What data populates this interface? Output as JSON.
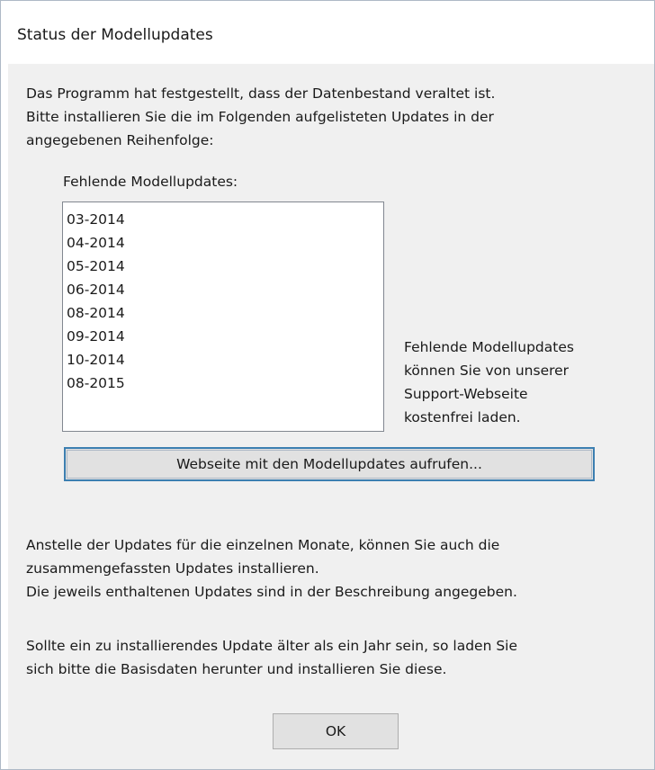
{
  "window": {
    "title": "Status der Modellupdates"
  },
  "intro": {
    "lines": [
      "Das Programm hat festgestellt, dass der Datenbestand veraltet ist.",
      "Bitte installieren Sie die im Folgenden aufgelisteten Updates in der",
      "angegebenen Reihenfolge:"
    ]
  },
  "missing_updates": {
    "label": "Fehlende Modellupdates:",
    "items": [
      "03-2014",
      "04-2014",
      "05-2014",
      "06-2014",
      "08-2014",
      "09-2014",
      "10-2014",
      "08-2015"
    ]
  },
  "side_note": {
    "lines": [
      "Fehlende Modellupdates",
      "können Sie von unserer",
      "Support-Webseite",
      "kostenfrei laden."
    ]
  },
  "buttons": {
    "website_label": "Webseite mit den Modellupdates aufrufen...",
    "ok_label": "OK"
  },
  "paragraph_combined": {
    "lines": [
      "Anstelle der Updates für die einzelnen Monate, können Sie auch die",
      "zusammengefassten Updates installieren.",
      "Die jeweils enthaltenen Updates sind in der Beschreibung angegeben."
    ]
  },
  "paragraph_basisdaten": {
    "lines": [
      "Sollte ein zu installierendes Update älter als ein Jahr sein, so laden Sie",
      "sich bitte die Basisdaten herunter und installieren Sie diese."
    ]
  },
  "colors": {
    "dialog_background": "#f0f0f0",
    "button_face": "#e1e1e1",
    "focus_border": "#3c7fb1"
  }
}
